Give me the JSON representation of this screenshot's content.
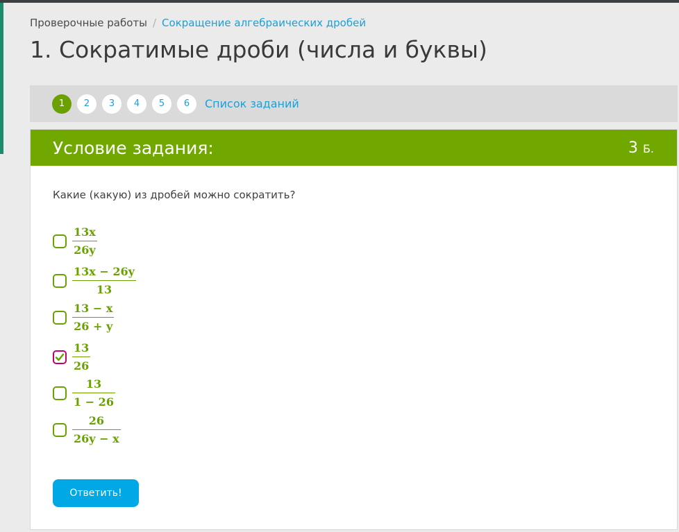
{
  "breadcrumb": {
    "parent": "Проверочные работы",
    "separator": "/",
    "current": "Сокращение алгебраических дробей"
  },
  "page_title": "1. Сократимые дроби (числа и буквы)",
  "task_nav": {
    "numbers": [
      "1",
      "2",
      "3",
      "4",
      "5",
      "6"
    ],
    "active_index": 0,
    "list_link": "Список заданий"
  },
  "card": {
    "title": "Условие задания:",
    "points_value": "3",
    "points_unit": "Б."
  },
  "question": "Какие (какую) из дробей можно сократить?",
  "options": [
    {
      "numerator": "13x",
      "denominator": "26y",
      "checked": false
    },
    {
      "numerator": "13x − 26y",
      "denominator": "13",
      "checked": false
    },
    {
      "numerator": "13 − x",
      "denominator": "26 + y",
      "checked": false
    },
    {
      "numerator": "13",
      "denominator": "26",
      "checked": true
    },
    {
      "numerator": "13",
      "denominator": "1 − 26",
      "checked": false
    },
    {
      "numerator": "26",
      "denominator": "26y − x",
      "checked": false
    }
  ],
  "submit_label": "Ответить!",
  "colors": {
    "accent_green": "#70a800",
    "link_blue": "#1aa0d8",
    "button_blue": "#00a8e6",
    "checked_border": "#c2006e"
  }
}
